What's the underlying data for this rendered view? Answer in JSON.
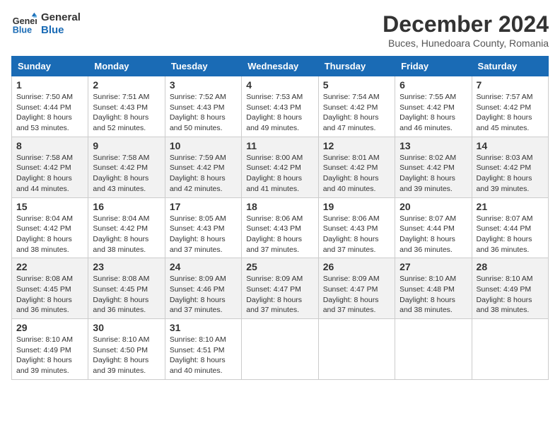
{
  "logo": {
    "line1": "General",
    "line2": "Blue"
  },
  "title": "December 2024",
  "location": "Buces, Hunedoara County, Romania",
  "weekdays": [
    "Sunday",
    "Monday",
    "Tuesday",
    "Wednesday",
    "Thursday",
    "Friday",
    "Saturday"
  ],
  "weeks": [
    [
      {
        "day": "1",
        "sunrise": "Sunrise: 7:50 AM",
        "sunset": "Sunset: 4:44 PM",
        "daylight": "Daylight: 8 hours and 53 minutes."
      },
      {
        "day": "2",
        "sunrise": "Sunrise: 7:51 AM",
        "sunset": "Sunset: 4:43 PM",
        "daylight": "Daylight: 8 hours and 52 minutes."
      },
      {
        "day": "3",
        "sunrise": "Sunrise: 7:52 AM",
        "sunset": "Sunset: 4:43 PM",
        "daylight": "Daylight: 8 hours and 50 minutes."
      },
      {
        "day": "4",
        "sunrise": "Sunrise: 7:53 AM",
        "sunset": "Sunset: 4:43 PM",
        "daylight": "Daylight: 8 hours and 49 minutes."
      },
      {
        "day": "5",
        "sunrise": "Sunrise: 7:54 AM",
        "sunset": "Sunset: 4:42 PM",
        "daylight": "Daylight: 8 hours and 47 minutes."
      },
      {
        "day": "6",
        "sunrise": "Sunrise: 7:55 AM",
        "sunset": "Sunset: 4:42 PM",
        "daylight": "Daylight: 8 hours and 46 minutes."
      },
      {
        "day": "7",
        "sunrise": "Sunrise: 7:57 AM",
        "sunset": "Sunset: 4:42 PM",
        "daylight": "Daylight: 8 hours and 45 minutes."
      }
    ],
    [
      {
        "day": "8",
        "sunrise": "Sunrise: 7:58 AM",
        "sunset": "Sunset: 4:42 PM",
        "daylight": "Daylight: 8 hours and 44 minutes."
      },
      {
        "day": "9",
        "sunrise": "Sunrise: 7:58 AM",
        "sunset": "Sunset: 4:42 PM",
        "daylight": "Daylight: 8 hours and 43 minutes."
      },
      {
        "day": "10",
        "sunrise": "Sunrise: 7:59 AM",
        "sunset": "Sunset: 4:42 PM",
        "daylight": "Daylight: 8 hours and 42 minutes."
      },
      {
        "day": "11",
        "sunrise": "Sunrise: 8:00 AM",
        "sunset": "Sunset: 4:42 PM",
        "daylight": "Daylight: 8 hours and 41 minutes."
      },
      {
        "day": "12",
        "sunrise": "Sunrise: 8:01 AM",
        "sunset": "Sunset: 4:42 PM",
        "daylight": "Daylight: 8 hours and 40 minutes."
      },
      {
        "day": "13",
        "sunrise": "Sunrise: 8:02 AM",
        "sunset": "Sunset: 4:42 PM",
        "daylight": "Daylight: 8 hours and 39 minutes."
      },
      {
        "day": "14",
        "sunrise": "Sunrise: 8:03 AM",
        "sunset": "Sunset: 4:42 PM",
        "daylight": "Daylight: 8 hours and 39 minutes."
      }
    ],
    [
      {
        "day": "15",
        "sunrise": "Sunrise: 8:04 AM",
        "sunset": "Sunset: 4:42 PM",
        "daylight": "Daylight: 8 hours and 38 minutes."
      },
      {
        "day": "16",
        "sunrise": "Sunrise: 8:04 AM",
        "sunset": "Sunset: 4:42 PM",
        "daylight": "Daylight: 8 hours and 38 minutes."
      },
      {
        "day": "17",
        "sunrise": "Sunrise: 8:05 AM",
        "sunset": "Sunset: 4:43 PM",
        "daylight": "Daylight: 8 hours and 37 minutes."
      },
      {
        "day": "18",
        "sunrise": "Sunrise: 8:06 AM",
        "sunset": "Sunset: 4:43 PM",
        "daylight": "Daylight: 8 hours and 37 minutes."
      },
      {
        "day": "19",
        "sunrise": "Sunrise: 8:06 AM",
        "sunset": "Sunset: 4:43 PM",
        "daylight": "Daylight: 8 hours and 37 minutes."
      },
      {
        "day": "20",
        "sunrise": "Sunrise: 8:07 AM",
        "sunset": "Sunset: 4:44 PM",
        "daylight": "Daylight: 8 hours and 36 minutes."
      },
      {
        "day": "21",
        "sunrise": "Sunrise: 8:07 AM",
        "sunset": "Sunset: 4:44 PM",
        "daylight": "Daylight: 8 hours and 36 minutes."
      }
    ],
    [
      {
        "day": "22",
        "sunrise": "Sunrise: 8:08 AM",
        "sunset": "Sunset: 4:45 PM",
        "daylight": "Daylight: 8 hours and 36 minutes."
      },
      {
        "day": "23",
        "sunrise": "Sunrise: 8:08 AM",
        "sunset": "Sunset: 4:45 PM",
        "daylight": "Daylight: 8 hours and 36 minutes."
      },
      {
        "day": "24",
        "sunrise": "Sunrise: 8:09 AM",
        "sunset": "Sunset: 4:46 PM",
        "daylight": "Daylight: 8 hours and 37 minutes."
      },
      {
        "day": "25",
        "sunrise": "Sunrise: 8:09 AM",
        "sunset": "Sunset: 4:47 PM",
        "daylight": "Daylight: 8 hours and 37 minutes."
      },
      {
        "day": "26",
        "sunrise": "Sunrise: 8:09 AM",
        "sunset": "Sunset: 4:47 PM",
        "daylight": "Daylight: 8 hours and 37 minutes."
      },
      {
        "day": "27",
        "sunrise": "Sunrise: 8:10 AM",
        "sunset": "Sunset: 4:48 PM",
        "daylight": "Daylight: 8 hours and 38 minutes."
      },
      {
        "day": "28",
        "sunrise": "Sunrise: 8:10 AM",
        "sunset": "Sunset: 4:49 PM",
        "daylight": "Daylight: 8 hours and 38 minutes."
      }
    ],
    [
      {
        "day": "29",
        "sunrise": "Sunrise: 8:10 AM",
        "sunset": "Sunset: 4:49 PM",
        "daylight": "Daylight: 8 hours and 39 minutes."
      },
      {
        "day": "30",
        "sunrise": "Sunrise: 8:10 AM",
        "sunset": "Sunset: 4:50 PM",
        "daylight": "Daylight: 8 hours and 39 minutes."
      },
      {
        "day": "31",
        "sunrise": "Sunrise: 8:10 AM",
        "sunset": "Sunset: 4:51 PM",
        "daylight": "Daylight: 8 hours and 40 minutes."
      },
      null,
      null,
      null,
      null
    ]
  ]
}
